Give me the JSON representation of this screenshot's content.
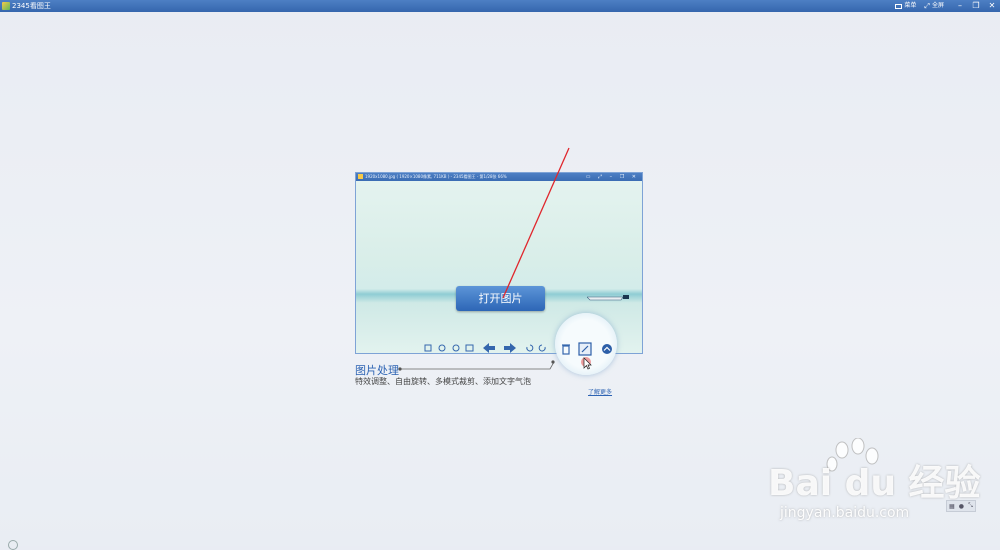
{
  "window": {
    "title": "2345看图王",
    "menu_label": "菜单",
    "fullscreen_label": "全屏",
    "minimize": "–",
    "restore": "❐",
    "close": "✕"
  },
  "preview": {
    "title_text": "1920x1080.jpg ( 1920×1080像素, 711KB ) - 2345看图王 - 第1/28张 66%",
    "open_button_label": "打开图片"
  },
  "feature": {
    "title": "图片处理",
    "description": "特效调整、自由旋转、多模式裁剪、添加文字气泡",
    "learn_more": "了解更多"
  },
  "watermark": {
    "line1": "Bai du 经验",
    "line2": "jingyan.baidu.com"
  },
  "colors": {
    "titlebar": "#3a6cb3",
    "accent": "#2d63b3",
    "arrow": "#e0262c"
  }
}
